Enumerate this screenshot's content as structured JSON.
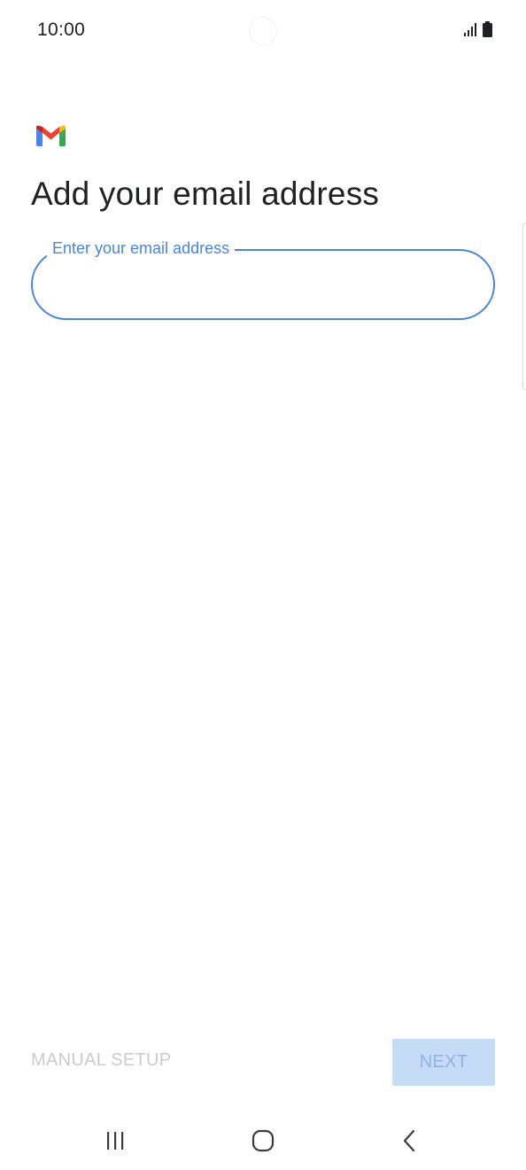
{
  "status_bar": {
    "time": "10:00",
    "icons": [
      "signal-icon",
      "battery-icon"
    ]
  },
  "app": {
    "logo": "gmail-logo-icon",
    "colors": {
      "accent": "#4a86d8",
      "gmail_red": "#ea4335",
      "gmail_blue": "#4285f4",
      "gmail_green": "#34a853",
      "gmail_yellow": "#fbbc04",
      "next_button_bg": "#c6dbf6",
      "next_button_text": "#8fb2e6",
      "disabled_text": "#c9cbce"
    }
  },
  "main": {
    "title": "Add your email address",
    "email_field": {
      "label": "Enter your email address",
      "value": ""
    }
  },
  "footer": {
    "manual_setup_label": "MANUAL SETUP",
    "next_label": "NEXT"
  },
  "nav_bar": {
    "icons": [
      "recent-apps-icon",
      "home-icon",
      "back-icon"
    ]
  }
}
